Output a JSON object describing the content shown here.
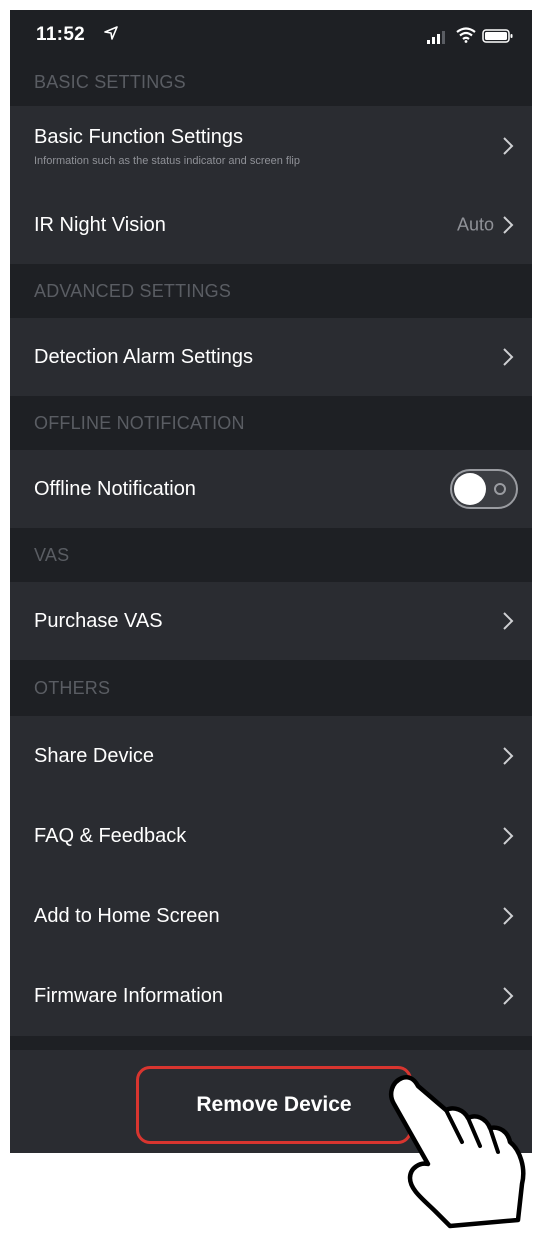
{
  "status_bar": {
    "time": "11:52"
  },
  "sections": {
    "basic": "BASIC SETTINGS",
    "advanced": "ADVANCED SETTINGS",
    "offline": "OFFLINE NOTIFICATION",
    "vas": "VAS",
    "others": "OTHERS"
  },
  "rows": {
    "basic_function": {
      "title": "Basic Function Settings",
      "subtitle": "Information such as the status indicator and screen flip"
    },
    "ir_night_vision": {
      "title": "IR Night Vision",
      "value": "Auto"
    },
    "detection_alarm": {
      "title": "Detection Alarm Settings"
    },
    "offline_notification": {
      "title": "Offline Notification",
      "enabled": false
    },
    "purchase_vas": {
      "title": "Purchase VAS"
    },
    "share_device": {
      "title": "Share Device"
    },
    "faq": {
      "title": "FAQ & Feedback"
    },
    "add_home": {
      "title": "Add to Home Screen"
    },
    "firmware": {
      "title": "Firmware Information"
    }
  },
  "remove_button": {
    "label": "Remove Device"
  },
  "colors": {
    "background": "#1e2024",
    "row": "#2a2c31",
    "section_text": "#5a5d63",
    "highlight": "#d8352f"
  }
}
